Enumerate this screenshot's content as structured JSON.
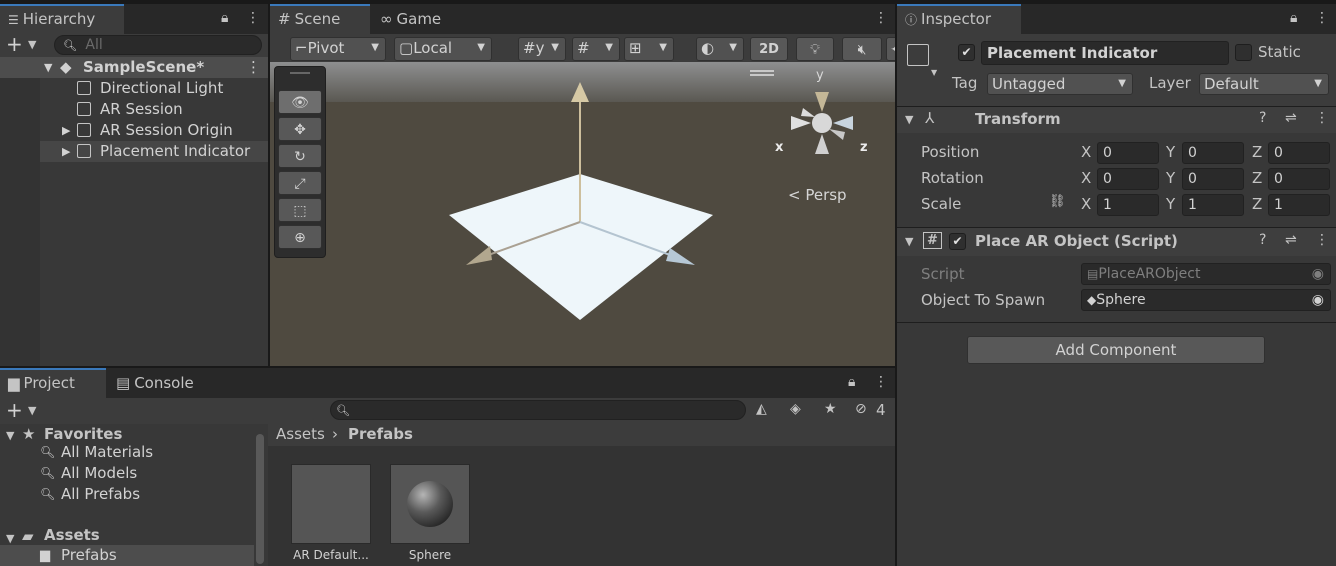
{
  "colors": {
    "accent": "#3a79bb",
    "panel": "#383838",
    "selected": "#4d4d4d",
    "scene_sky": "#6a6a66",
    "scene_ground": "#4f4a40",
    "plane": "#eef6fa"
  },
  "hierarchy": {
    "tab": "Hierarchy",
    "search_placeholder": "All",
    "scene_name": "SampleScene*",
    "items": [
      {
        "label": "Directional Light"
      },
      {
        "label": "AR Session"
      },
      {
        "label": "AR Session Origin"
      },
      {
        "label": "Placement Indicator"
      }
    ]
  },
  "scene": {
    "tabs": [
      {
        "label": "Scene"
      },
      {
        "label": "Game"
      }
    ],
    "toolbar": {
      "pivot": "Pivot",
      "local": "Local",
      "mode_2d": "2D"
    },
    "gizmo": {
      "x": "x",
      "y": "y",
      "z": "z",
      "persp": "< Persp"
    }
  },
  "inspector": {
    "tab": "Inspector",
    "object_name": "Placement Indicator",
    "static_label": "Static",
    "tag_label": "Tag",
    "tag_value": "Untagged",
    "layer_label": "Layer",
    "layer_value": "Default",
    "transform": {
      "title": "Transform",
      "position": {
        "label": "Position",
        "x": "0",
        "y": "0",
        "z": "0"
      },
      "rotation": {
        "label": "Rotation",
        "x": "0",
        "y": "0",
        "z": "0"
      },
      "scale": {
        "label": "Scale",
        "x": "1",
        "y": "1",
        "z": "1"
      },
      "axis": {
        "x": "X",
        "y": "Y",
        "z": "Z"
      }
    },
    "script_component": {
      "title": "Place AR Object (Script)",
      "script_label": "Script",
      "script_value": "PlaceARObject",
      "spawn_label": "Object To Spawn",
      "spawn_value": "Sphere"
    },
    "add_component": "Add Component"
  },
  "project": {
    "tabs": [
      {
        "label": "Project"
      },
      {
        "label": "Console"
      }
    ],
    "hidden_count": "4",
    "favorites_label": "Favorites",
    "favorites": [
      {
        "label": "All Materials"
      },
      {
        "label": "All Models"
      },
      {
        "label": "All Prefabs"
      }
    ],
    "assets_label": "Assets",
    "prefabs_folder": "Prefabs",
    "breadcrumb": {
      "root": "Assets",
      "current": "Prefabs"
    },
    "assets": [
      {
        "label": "AR Default..."
      },
      {
        "label": "Sphere"
      }
    ]
  }
}
